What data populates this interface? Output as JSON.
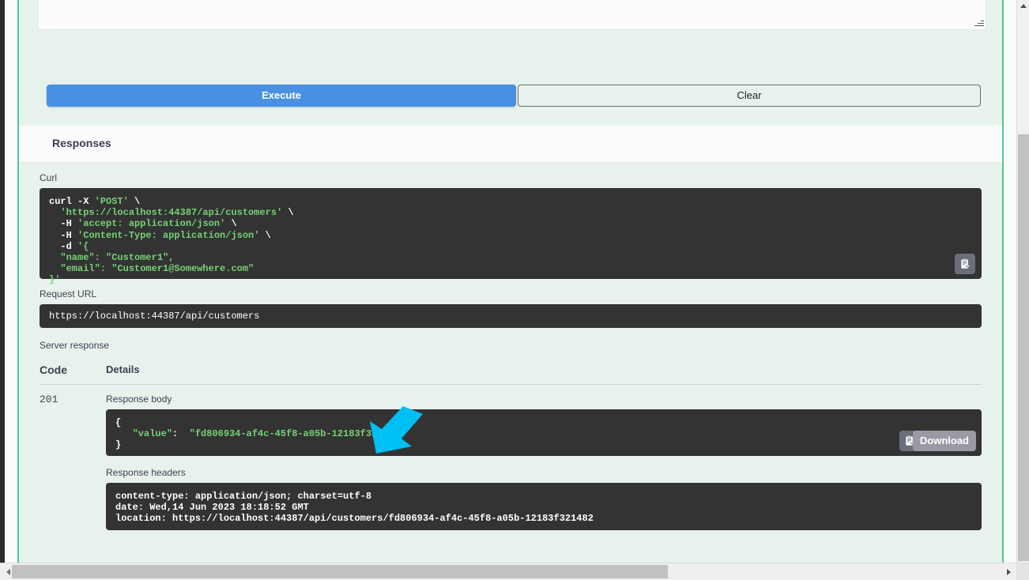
{
  "window": {
    "background_color": "#2b2b2b",
    "page_background": "#fbfbfb"
  },
  "opblock": {
    "accent_color": "#49cc90",
    "body_background": "#e7f2ec"
  },
  "request_body_editor": {
    "value": "",
    "placeholder": ""
  },
  "actions": {
    "execute_label": "Execute",
    "execute_color": "#4990e2",
    "clear_label": "Clear"
  },
  "responses": {
    "section_title": "Responses",
    "curl": {
      "label": "Curl",
      "copy_icon": "clipboard-copy-icon",
      "lines": [
        [
          {
            "text": "curl",
            "type": "kw"
          },
          {
            "text": " ",
            "type": "plain"
          },
          {
            "text": "-X",
            "type": "flag"
          },
          {
            "text": " ",
            "type": "plain"
          },
          {
            "text": "'POST'",
            "type": "str"
          },
          {
            "text": " \\",
            "type": "plain"
          }
        ],
        [
          {
            "text": "  ",
            "type": "plain"
          },
          {
            "text": "'https://localhost:44387/api/customers'",
            "type": "str"
          },
          {
            "text": " \\",
            "type": "plain"
          }
        ],
        [
          {
            "text": "  ",
            "type": "plain"
          },
          {
            "text": "-H",
            "type": "flag"
          },
          {
            "text": " ",
            "type": "plain"
          },
          {
            "text": "'accept: application/json'",
            "type": "str"
          },
          {
            "text": " \\",
            "type": "plain"
          }
        ],
        [
          {
            "text": "  ",
            "type": "plain"
          },
          {
            "text": "-H",
            "type": "flag"
          },
          {
            "text": " ",
            "type": "plain"
          },
          {
            "text": "'Content-Type: application/json'",
            "type": "str"
          },
          {
            "text": " \\",
            "type": "plain"
          }
        ],
        [
          {
            "text": "  ",
            "type": "plain"
          },
          {
            "text": "-d",
            "type": "flag"
          },
          {
            "text": " ",
            "type": "plain"
          },
          {
            "text": "'{",
            "type": "str"
          }
        ],
        [
          {
            "text": "  ",
            "type": "plain"
          },
          {
            "text": "\"name\": \"Customer1\",",
            "type": "str"
          }
        ],
        [
          {
            "text": "  ",
            "type": "plain"
          },
          {
            "text": "\"email\": \"Customer1@Somewhere.com\"",
            "type": "str"
          }
        ],
        [
          {
            "text": "}'",
            "type": "str"
          }
        ]
      ],
      "plain_text": "curl -X 'POST' \\\n  'https://localhost:44387/api/customers' \\\n  -H 'accept: application/json' \\\n  -H 'Content-Type: application/json' \\\n  -d '{\n  \"name\": \"Customer1\",\n  \"email\": \"Customer1@Somewhere.com\"\n}'"
    },
    "request_url": {
      "label": "Request URL",
      "value": "https://localhost:44387/api/customers"
    },
    "server_response": {
      "label": "Server response",
      "columns": {
        "code": "Code",
        "details": "Details"
      },
      "rows": [
        {
          "code": "201",
          "response_body": {
            "label": "Response body",
            "lines": [
              {
                "text": "{",
                "type": "plain"
              },
              {
                "text": "   \"value\": \"fd806934-af4c-45f8-a05b-12183f321482\"",
                "type": "mixed"
              },
              {
                "text": "}",
                "type": "plain"
              }
            ],
            "key": "\"value\"",
            "value": "\"fd806934-af4c-45f8-a05b-12183f321482\"",
            "copy_icon": "clipboard-copy-icon",
            "download_label": "Download"
          },
          "response_headers": {
            "label": "Response headers",
            "lines": [
              "content-type: application/json; charset=utf-8",
              "date: Wed,14 Jun 2023 18:18:52 GMT",
              "location: https://localhost:44387/api/customers/fd806934-af4c-45f8-a05b-12183f321482"
            ]
          }
        }
      ]
    }
  },
  "annotation": {
    "arrow_cursor": "arrow-pointer-icon",
    "arrow_color": "#00bff3"
  },
  "scrollbars": {
    "vertical": {
      "thumb_color": "#c1c1c1",
      "track_color": "#f0f0f0",
      "up_icon": "triangle-up-icon"
    },
    "horizontal": {
      "thumb_color": "#c1c1c1",
      "track_color": "#efefef",
      "left_icon": "triangle-left-icon",
      "right_icon": "triangle-right-icon"
    }
  }
}
